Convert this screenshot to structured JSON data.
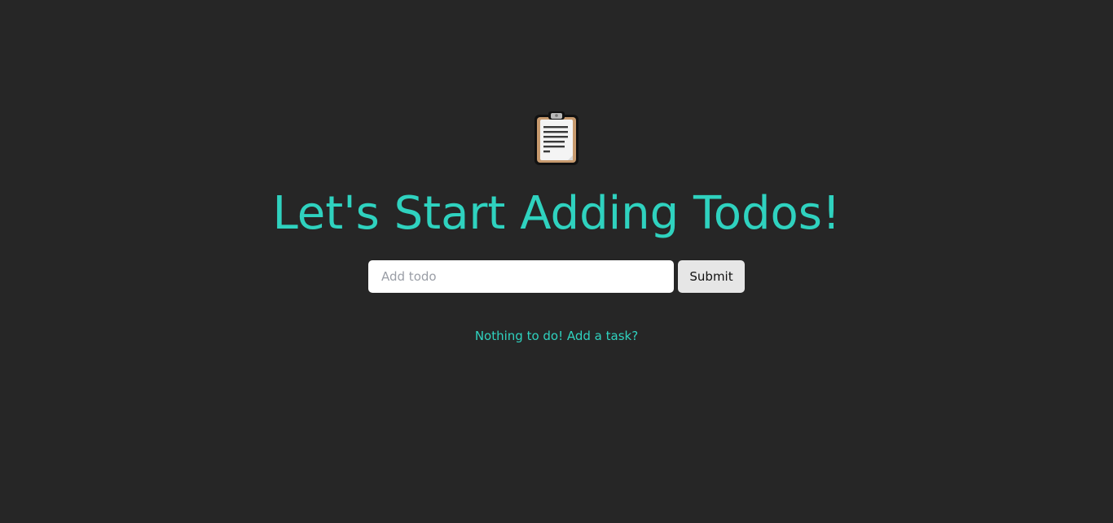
{
  "header": {
    "icon": "clipboard-icon",
    "title": "Let's Start Adding Todos!"
  },
  "form": {
    "input_placeholder": "Add todo",
    "input_value": "",
    "submit_label": "Submit"
  },
  "empty_state": {
    "message": "Nothing to do! Add a task?"
  },
  "colors": {
    "background": "#262626",
    "accent": "#2fd2bf",
    "input_background": "#ffffff",
    "button_background": "#e6e6e6"
  }
}
